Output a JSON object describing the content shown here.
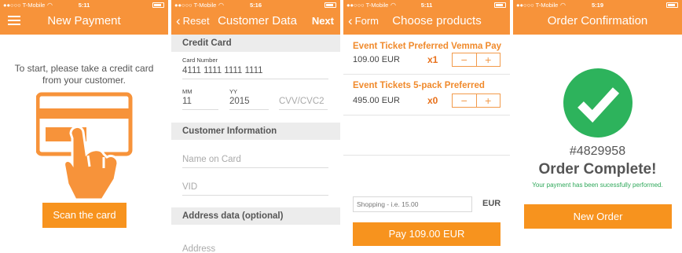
{
  "status": {
    "carrier": "●●○○○ T-Mobile",
    "screens": [
      {
        "time": "5:11"
      },
      {
        "time": "5:16"
      },
      {
        "time": "5:11"
      },
      {
        "time": "5:19"
      }
    ]
  },
  "screen1": {
    "title": "New Payment",
    "intro_line1": "To start, please take a credit card",
    "intro_line2": "from your customer.",
    "scan_button": "Scan the card"
  },
  "screen2": {
    "back_label": "Reset",
    "title": "Customer Data",
    "next_label": "Next",
    "credit_card_section": "Credit Card",
    "card_number_label": "Card Number",
    "card_number_value": "4111 1111 1111 1111",
    "mm_label": "MM",
    "mm_value": "11",
    "yy_label": "YY",
    "yy_value": "2015",
    "cvv_placeholder": "CVV/CVC2",
    "customer_section": "Customer Information",
    "name_placeholder": "Name on Card",
    "vid_placeholder": "VID",
    "address_section": "Address data (optional)",
    "address_placeholder": "Address"
  },
  "screen3": {
    "back_label": "Form",
    "title": "Choose products",
    "products": [
      {
        "name": "Event Ticket Preferred Vemma Pay",
        "price": "109.00 EUR",
        "qty": "x1"
      },
      {
        "name": "Event Tickets 5-pack Preferred",
        "price": "495.00 EUR",
        "qty": "x0"
      }
    ],
    "stepper_minus": "−",
    "stepper_plus": "+",
    "shopping_placeholder": "Shopping - i.e. 15.00",
    "currency": "EUR",
    "pay_button": "Pay 109.00 EUR"
  },
  "screen4": {
    "title": "Order Confirmation",
    "order_number": "#4829958",
    "headline": "Order Complete!",
    "message": "Your payment has been sucessfully performed.",
    "new_order_button": "New Order"
  },
  "colors": {
    "accent": "#f7933a",
    "success": "#2db35c",
    "product_name": "#f08a2c"
  }
}
